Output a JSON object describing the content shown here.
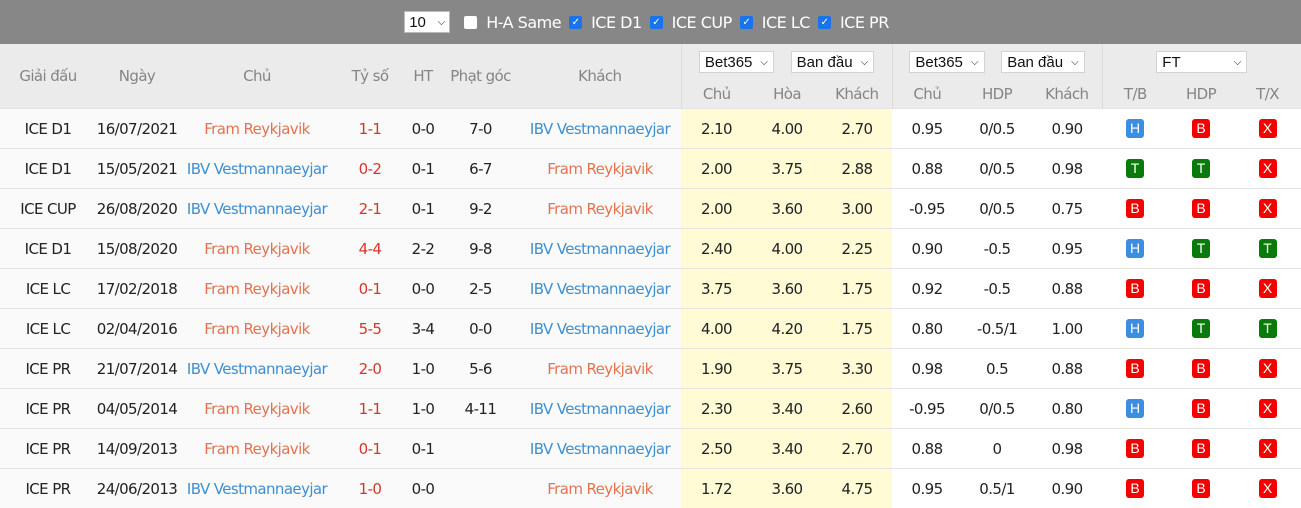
{
  "topbar": {
    "count_select": "10",
    "filters": [
      {
        "label": "H-A Same",
        "checked": false
      },
      {
        "label": "ICE D1",
        "checked": true
      },
      {
        "label": "ICE CUP",
        "checked": true
      },
      {
        "label": "ICE LC",
        "checked": true
      },
      {
        "label": "ICE PR",
        "checked": true
      }
    ]
  },
  "header": {
    "league": "Giải đấu",
    "date": "Ngày",
    "home": "Chủ",
    "score": "Tỷ số",
    "ht": "HT",
    "corners": "Phạt góc",
    "away": "Khách",
    "odds1_bookmaker": "Bet365",
    "odds1_type": "Ban đầu",
    "odds2_bookmaker": "Bet365",
    "odds2_type": "Ban đầu",
    "result_period": "FT",
    "odds1_cols": [
      "Chủ",
      "Hòa",
      "Khách"
    ],
    "odds2_cols": [
      "Chủ",
      "HDP",
      "Khách"
    ],
    "result_cols": [
      "T/B",
      "HDP",
      "T/X"
    ]
  },
  "colors": {
    "fram": "#e2744f",
    "ibv": "#3d8fd1",
    "score": "#d9342b",
    "badge_H": "#3b8fde",
    "badge_B": "#f40000",
    "badge_T": "#0a7b0a",
    "badge_X": "#f40000"
  },
  "rows": [
    {
      "league": "ICE D1",
      "date": "16/07/2021",
      "home": "Fram Reykjavik",
      "home_team": "fram",
      "score": "1-1",
      "ht": "0-0",
      "corners": "7-0",
      "away": "IBV Vestmannaeyjar",
      "away_team": "ibv",
      "o1": "2.10",
      "ox": "4.00",
      "o2": "2.70",
      "h1": "0.95",
      "hdp": "0/0.5",
      "h2": "0.90",
      "tb": "H",
      "rhdp": "B",
      "tx": "X"
    },
    {
      "league": "ICE D1",
      "date": "15/05/2021",
      "home": "IBV Vestmannaeyjar",
      "home_team": "ibv",
      "score": "0-2",
      "ht": "0-1",
      "corners": "6-7",
      "away": "Fram Reykjavik",
      "away_team": "fram",
      "o1": "2.00",
      "ox": "3.75",
      "o2": "2.88",
      "h1": "0.88",
      "hdp": "0/0.5",
      "h2": "0.98",
      "tb": "T",
      "rhdp": "T",
      "tx": "X"
    },
    {
      "league": "ICE CUP",
      "date": "26/08/2020",
      "home": "IBV Vestmannaeyjar",
      "home_team": "ibv",
      "score": "2-1",
      "ht": "0-1",
      "corners": "9-2",
      "away": "Fram Reykjavik",
      "away_team": "fram",
      "o1": "2.00",
      "ox": "3.60",
      "o2": "3.00",
      "h1": "-0.95",
      "hdp": "0/0.5",
      "h2": "0.75",
      "tb": "B",
      "rhdp": "B",
      "tx": "X"
    },
    {
      "league": "ICE D1",
      "date": "15/08/2020",
      "home": "Fram Reykjavik",
      "home_team": "fram",
      "score": "4-4",
      "ht": "2-2",
      "corners": "9-8",
      "away": "IBV Vestmannaeyjar",
      "away_team": "ibv",
      "o1": "2.40",
      "ox": "4.00",
      "o2": "2.25",
      "h1": "0.90",
      "hdp": "-0.5",
      "h2": "0.95",
      "tb": "H",
      "rhdp": "T",
      "tx": "T"
    },
    {
      "league": "ICE LC",
      "date": "17/02/2018",
      "home": "Fram Reykjavik",
      "home_team": "fram",
      "score": "0-1",
      "ht": "0-0",
      "corners": "2-5",
      "away": "IBV Vestmannaeyjar",
      "away_team": "ibv",
      "o1": "3.75",
      "ox": "3.60",
      "o2": "1.75",
      "h1": "0.92",
      "hdp": "-0.5",
      "h2": "0.88",
      "tb": "B",
      "rhdp": "B",
      "tx": "X"
    },
    {
      "league": "ICE LC",
      "date": "02/04/2016",
      "home": "Fram Reykjavik",
      "home_team": "fram",
      "score": "5-5",
      "ht": "3-4",
      "corners": "0-0",
      "away": "IBV Vestmannaeyjar",
      "away_team": "ibv",
      "o1": "4.00",
      "ox": "4.20",
      "o2": "1.75",
      "h1": "0.80",
      "hdp": "-0.5/1",
      "h2": "1.00",
      "tb": "H",
      "rhdp": "T",
      "tx": "T"
    },
    {
      "league": "ICE PR",
      "date": "21/07/2014",
      "home": "IBV Vestmannaeyjar",
      "home_team": "ibv",
      "score": "2-0",
      "ht": "1-0",
      "corners": "5-6",
      "away": "Fram Reykjavik",
      "away_team": "fram",
      "o1": "1.90",
      "ox": "3.75",
      "o2": "3.30",
      "h1": "0.98",
      "hdp": "0.5",
      "h2": "0.88",
      "tb": "B",
      "rhdp": "B",
      "tx": "X"
    },
    {
      "league": "ICE PR",
      "date": "04/05/2014",
      "home": "Fram Reykjavik",
      "home_team": "fram",
      "score": "1-1",
      "ht": "1-0",
      "corners": "4-11",
      "away": "IBV Vestmannaeyjar",
      "away_team": "ibv",
      "o1": "2.30",
      "ox": "3.40",
      "o2": "2.60",
      "h1": "-0.95",
      "hdp": "0/0.5",
      "h2": "0.80",
      "tb": "H",
      "rhdp": "B",
      "tx": "X"
    },
    {
      "league": "ICE PR",
      "date": "14/09/2013",
      "home": "Fram Reykjavik",
      "home_team": "fram",
      "score": "0-1",
      "ht": "0-1",
      "corners": "",
      "away": "IBV Vestmannaeyjar",
      "away_team": "ibv",
      "o1": "2.50",
      "ox": "3.40",
      "o2": "2.70",
      "h1": "0.88",
      "hdp": "0",
      "h2": "0.98",
      "tb": "B",
      "rhdp": "B",
      "tx": "X"
    },
    {
      "league": "ICE PR",
      "date": "24/06/2013",
      "home": "IBV Vestmannaeyjar",
      "home_team": "ibv",
      "score": "1-0",
      "ht": "0-0",
      "corners": "",
      "away": "Fram Reykjavik",
      "away_team": "fram",
      "o1": "1.72",
      "ox": "3.60",
      "o2": "4.75",
      "h1": "0.95",
      "hdp": "0.5/1",
      "h2": "0.90",
      "tb": "B",
      "rhdp": "B",
      "tx": "X"
    }
  ]
}
